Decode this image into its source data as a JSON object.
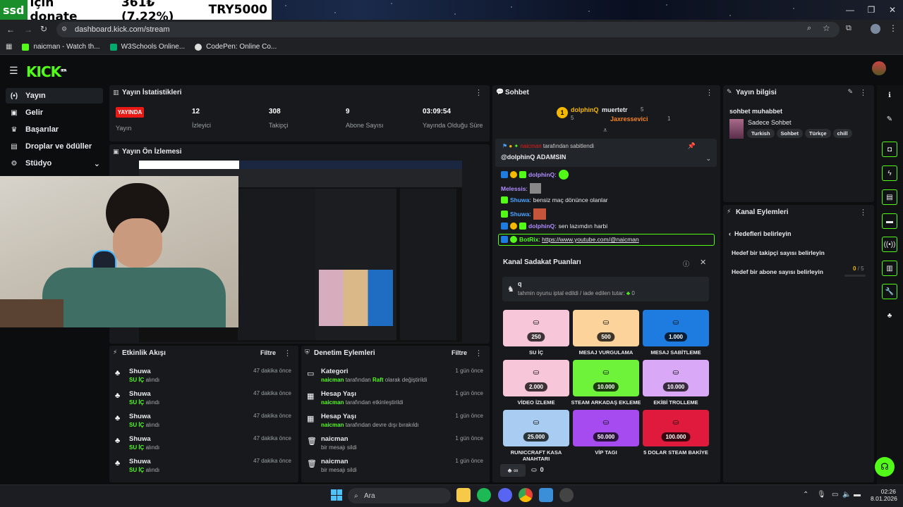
{
  "overlay": {
    "ssd": "ssd",
    "donate_text": "için donate",
    "amount": "361₺ (7.22%)",
    "goal": "TRY5000"
  },
  "browser": {
    "url": "dashboard.kick.com/stream",
    "bookmarks": [
      "naicman - Watch th...",
      "W3Schools Online...",
      "CodePen: Online Co..."
    ]
  },
  "app": {
    "logo": "KICK",
    "beta": "BETA"
  },
  "sidebar": {
    "items": [
      {
        "label": "Yayın",
        "icon": "broadcast-icon"
      },
      {
        "label": "Gelir",
        "icon": "wallet-icon"
      },
      {
        "label": "Başarılar",
        "icon": "trophy-icon"
      },
      {
        "label": "Droplar ve ödüller",
        "icon": "gift-icon"
      },
      {
        "label": "Stüdyo",
        "icon": "studio-icon"
      }
    ]
  },
  "stats": {
    "title": "Yayın İstatistikleri",
    "live_badge": "YAYINDA",
    "items": [
      {
        "value": "",
        "label": "Yayın"
      },
      {
        "value": "12",
        "label": "İzleyici"
      },
      {
        "value": "308",
        "label": "Takipçi"
      },
      {
        "value": "9",
        "label": "Abone Sayısı"
      },
      {
        "value": "03:09:54",
        "label": "Yayında Olduğu Süre"
      }
    ]
  },
  "preview": {
    "title": "Yayın Ön İzlemesi"
  },
  "activity": {
    "title": "Etkinlik Akışı",
    "filter": "Filtre",
    "rows": [
      {
        "name": "Shuwa",
        "reward": "SU İÇ",
        "suffix": "alındı",
        "time": "47 dakika önce"
      },
      {
        "name": "Shuwa",
        "reward": "SU İÇ",
        "suffix": "alındı",
        "time": "47 dakika önce"
      },
      {
        "name": "Shuwa",
        "reward": "SU İÇ",
        "suffix": "alındı",
        "time": "47 dakika önce"
      },
      {
        "name": "Shuwa",
        "reward": "SU İÇ",
        "suffix": "alındı",
        "time": "47 dakika önce"
      },
      {
        "name": "Shuwa",
        "reward": "SU İÇ",
        "suffix": "alındı",
        "time": "47 dakika önce"
      }
    ]
  },
  "moderation": {
    "title": "Denetim Eylemleri",
    "filter": "Filtre",
    "rows": [
      {
        "name": "Kategori",
        "actor": "naicman",
        "text": "tarafından",
        "hl": "Raft",
        "text2": "olarak değiştirildi",
        "time": "1 gün önce"
      },
      {
        "name": "Hesap Yaşı",
        "actor": "naicman",
        "text": "tarafından etkinleştirildi",
        "hl": "",
        "text2": "",
        "time": "1 gün önce"
      },
      {
        "name": "Hesap Yaşı",
        "actor": "naicman",
        "text": "tarafından devre dışı bırakıldı",
        "hl": "",
        "text2": "",
        "time": "1 gün önce"
      },
      {
        "name": "naicman",
        "actor": "",
        "text": "bir mesajı sildi",
        "hl": "",
        "text2": "",
        "time": "1 gün önce"
      },
      {
        "name": "naicman",
        "actor": "",
        "text": "bir mesajı sildi",
        "hl": "",
        "text2": "",
        "time": "1 gün önce"
      }
    ]
  },
  "chat": {
    "title": "Sohbet",
    "top_gifters": [
      {
        "name": "dolphinQ",
        "count": "5"
      },
      {
        "name": "muertetr",
        "count": "5"
      },
      {
        "name": "Jaxressevici",
        "count": "1"
      }
    ],
    "pinned_by": "tarafından sabitlendi",
    "pinned_msg": "@dolphinQ ADAMSIN",
    "messages": [
      {
        "user": "dolphinQ",
        "text": "",
        "color": "#b18cff"
      },
      {
        "user": "Melessis",
        "text": "",
        "color": "#b18cff"
      },
      {
        "user": "Shuwa",
        "text": "bensiz maç dönünce olanlar",
        "color": "#4aa3ff"
      },
      {
        "user": "Shuwa",
        "text": "",
        "color": "#4aa3ff"
      },
      {
        "user": "dolphinQ",
        "text": "sen lazımdın harbi",
        "color": "#b18cff"
      },
      {
        "user": "BotRix",
        "text": "https://www.youtube.com/@naicman",
        "color": "#53fc18"
      }
    ]
  },
  "loyalty": {
    "title": "Kanal Sadakat Puanları",
    "prediction_title": "q",
    "prediction_text": "tahmin oyunu iptal edildi / iade edilen tutar:",
    "prediction_amount": "0",
    "rewards": [
      {
        "cost": "250",
        "label": "SU İÇ",
        "color": "#f7c6d9"
      },
      {
        "cost": "500",
        "label": "MESAJ VURGULAMA",
        "color": "#fcd39a"
      },
      {
        "cost": "1.000",
        "label": "MESAJ SABİTLEME",
        "color": "#1e7be0"
      },
      {
        "cost": "2.000",
        "label": "VİDEO İZLEME",
        "color": "#f7c6d9"
      },
      {
        "cost": "10.000",
        "label": "STEAM ARKADAŞ EKLEME",
        "color": "#6ef23a"
      },
      {
        "cost": "10.000",
        "label": "EKİBİ TROLLEME",
        "color": "#d9a8f7"
      },
      {
        "cost": "25.000",
        "label": "RUNICCRAFT KASA ANAHTARI",
        "color": "#a9cdf2"
      },
      {
        "cost": "50.000",
        "label": "VİP TAGI",
        "color": "#a64bf0"
      },
      {
        "cost": "100.000",
        "label": "5 DOLAR STEAM BAKİYE",
        "color": "#e01a3c"
      }
    ],
    "footer_points": "0",
    "footer_inf": "∞"
  },
  "stream_info": {
    "title": "Yayın bilgisi",
    "stream_title": "sohbet muhabbet",
    "category": "Sadece Sohbet",
    "tags": [
      "Turkish",
      "Sohbet",
      "Türkçe",
      "chill"
    ]
  },
  "channel_actions": {
    "title": "Kanal Eylemleri",
    "back_label": "Hedefleri belirleyin",
    "items": [
      {
        "label": "Hedef bir takipçi sayısı belirleyin",
        "value": ""
      },
      {
        "label": "Hedef bir abone sayısı belirleyin",
        "value": "0",
        "max": "/ 5"
      }
    ]
  },
  "taskbar": {
    "search": "Ara",
    "time": "02:26",
    "date": "8.01.2026"
  }
}
